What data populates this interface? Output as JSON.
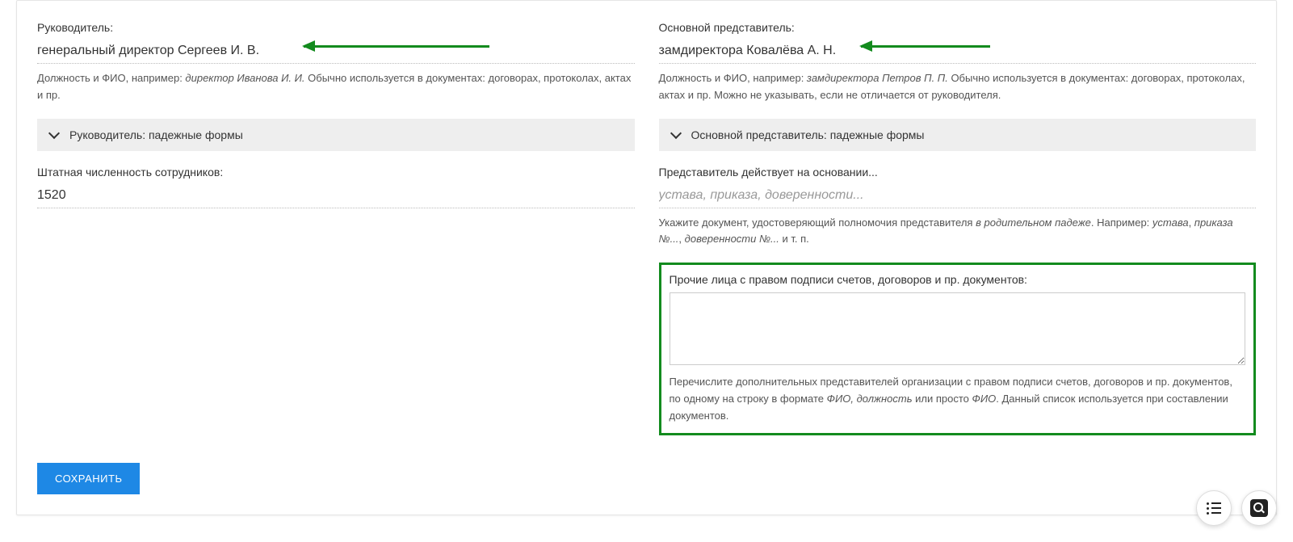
{
  "left": {
    "manager": {
      "label": "Руководитель:",
      "value": "генеральный директор Сергеев И. В.",
      "hint_prefix": "Должность и ФИО, например: ",
      "hint_example": "директор Иванова И. И.",
      "hint_suffix": " Обычно используется в документах: договорах, протоколах, актах и пр."
    },
    "collapsible": "Руководитель: падежные формы",
    "staff": {
      "label": "Штатная численность сотрудников:",
      "value": "1520"
    }
  },
  "right": {
    "rep": {
      "label": "Основной представитель:",
      "value": "замдиректора Ковалёва А. Н.",
      "hint_prefix": "Должность и ФИО, например: ",
      "hint_example": "замдиректора Петров П. П.",
      "hint_suffix": " Обычно используется в документах: договорах, протоколах, актах и пр. Можно не указывать, если не отличается от руководителя."
    },
    "collapsible": "Основной представитель: падежные формы",
    "basis": {
      "label": "Представитель действует на основании...",
      "placeholder": "устава, приказа, доверенности...",
      "hint_prefix": "Укажите документ, удостоверяющий полномочия представителя ",
      "hint_em1": "в родительном падеже",
      "hint_mid": ". Например: ",
      "hint_em2": "устава",
      "hint_comma": ", ",
      "hint_em3": "приказа №...",
      "hint_comma2": ", ",
      "hint_em4": "доверенности №...",
      "hint_suffix": " и т. п."
    },
    "others": {
      "label": "Прочие лица с правом подписи счетов, договоров и пр. документов:",
      "hint_prefix": "Перечислите дополнительных представителей организации с правом подписи счетов, договоров и пр. документов, по одному на строку в формате ",
      "hint_em1": "ФИО, должность",
      "hint_mid": " или просто ",
      "hint_em2": "ФИО",
      "hint_suffix": ". Данный список используется при составлении документов."
    }
  },
  "save": "СОХРАНИТЬ"
}
